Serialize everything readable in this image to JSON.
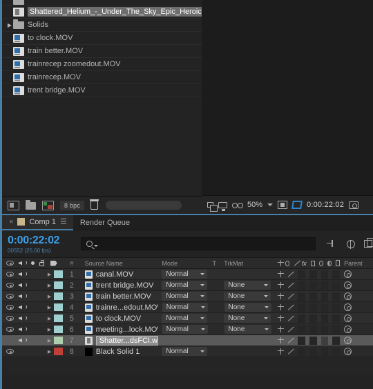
{
  "project_panel": {
    "items": [
      {
        "name": "",
        "type": "partial-row",
        "icon": "folder-icon",
        "indent": 0,
        "selected": false,
        "partial": true
      },
      {
        "name": "Shattered_Helium_-_Under_The_Sky_Epic_Heroic_",
        "type": "audio",
        "icon": "audio-file-icon",
        "indent": 1,
        "selected": true
      },
      {
        "name": "Solids",
        "type": "folder",
        "icon": "folder-icon",
        "indent": 0,
        "selected": false,
        "expander": "▶"
      },
      {
        "name": "to clock.MOV",
        "type": "movie",
        "icon": "movie-file-icon",
        "indent": 1,
        "selected": false
      },
      {
        "name": "train better.MOV",
        "type": "movie",
        "icon": "movie-file-icon",
        "indent": 1,
        "selected": false
      },
      {
        "name": "trainrecep zoomedout.MOV",
        "type": "movie",
        "icon": "movie-file-icon",
        "indent": 1,
        "selected": false
      },
      {
        "name": "trainrecep.MOV",
        "type": "movie",
        "icon": "movie-file-icon",
        "indent": 1,
        "selected": false
      },
      {
        "name": "trent bridge.MOV",
        "type": "movie",
        "icon": "movie-file-icon",
        "indent": 1,
        "selected": false
      }
    ],
    "footer": {
      "interpret_icon": "interpret-footage-icon",
      "new_folder_icon": "new-folder-icon",
      "new_comp_icon": "new-composition-icon",
      "bit_depth": "8 bpc",
      "delete_icon": "trash-icon"
    }
  },
  "viewer": {
    "toolbar": {
      "layers_icon": "toggle-view-layouts-icon",
      "monitor_icon": "always-preview-icon",
      "stereo_icon": "3d-glasses-icon",
      "zoom_level": "50%",
      "roi_icon": "region-of-interest-icon",
      "transparency_grid_icon": "transparency-grid-icon",
      "timecode": "0:00:22:02",
      "snapshot_icon": "snapshot-camera-icon"
    }
  },
  "timeline": {
    "tabs": [
      {
        "label": "Comp 1",
        "active": true,
        "close_icon": "close-icon",
        "menu_icon": "panel-menu-icon"
      },
      {
        "label": "Render Queue",
        "active": false
      }
    ],
    "current_time": "0:00:22:02",
    "frame_info": "00552 (25.00 fps)",
    "search_placeholder": "",
    "search_value": "",
    "toolbar_icons": [
      "composition-mini-flowchart-icon",
      "draft-3d-icon",
      "renderer-options-icon"
    ],
    "columns": {
      "video_icon": "eye-icon",
      "audio_icon": "speaker-icon",
      "solo_icon": "solo-dot-icon",
      "lock_icon": "lock-icon",
      "label_icon": "label-tag-icon",
      "number": "#",
      "source_name": "Source Name",
      "mode": "Mode",
      "t": "T",
      "trkmat": "TrkMat",
      "switches": [
        "shy-icon",
        "collapse-transformations-icon",
        "quality-icon",
        "effects-fx-icon",
        "frame-blending-icon",
        "motion-blur-icon",
        "adjustment-layer-icon",
        "3d-layer-icon"
      ],
      "parent": "Parent"
    },
    "layers": [
      {
        "num": "1",
        "name": "canal.MOV",
        "kind": "movie",
        "label_color": "#9fcfcf",
        "video": true,
        "audio": true,
        "mode": "Normal",
        "trkmat": null,
        "selected": false
      },
      {
        "num": "2",
        "name": "trent bridge.MOV",
        "kind": "movie",
        "label_color": "#9fcfcf",
        "video": true,
        "audio": true,
        "mode": "Normal",
        "trkmat": "None",
        "selected": false
      },
      {
        "num": "3",
        "name": "train better.MOV",
        "kind": "movie",
        "label_color": "#9fcfcf",
        "video": true,
        "audio": true,
        "mode": "Normal",
        "trkmat": "None",
        "selected": false
      },
      {
        "num": "4",
        "name": "trainre...edout.MOV",
        "kind": "movie",
        "label_color": "#9fcfcf",
        "video": true,
        "audio": true,
        "mode": "Normal",
        "trkmat": "None",
        "selected": false
      },
      {
        "num": "5",
        "name": "to clock.MOV",
        "kind": "movie",
        "label_color": "#9fcfcf",
        "video": true,
        "audio": true,
        "mode": "Normal",
        "trkmat": "None",
        "selected": false
      },
      {
        "num": "6",
        "name": "meeting...lock.MOV",
        "kind": "movie",
        "label_color": "#9fcfcf",
        "video": true,
        "audio": true,
        "mode": "Normal",
        "trkmat": "None",
        "selected": false
      },
      {
        "num": "7",
        "name": "Shatter...dsFCI.wav",
        "kind": "audio",
        "label_color": "#aecfae",
        "video": false,
        "audio": true,
        "mode": null,
        "trkmat": null,
        "selected": true
      },
      {
        "num": "8",
        "name": "Black Solid 1",
        "kind": "solid",
        "label_color": "#c04038",
        "video": true,
        "audio": false,
        "mode": "Normal",
        "trkmat": null,
        "selected": false
      }
    ]
  },
  "colors": {
    "accent_blue": "#4a7fa8",
    "timecode_blue": "#3b9ee8",
    "panel_bg": "#232323",
    "row_bg": "#2e2e2e",
    "selected_row": "#5a5a5a"
  }
}
